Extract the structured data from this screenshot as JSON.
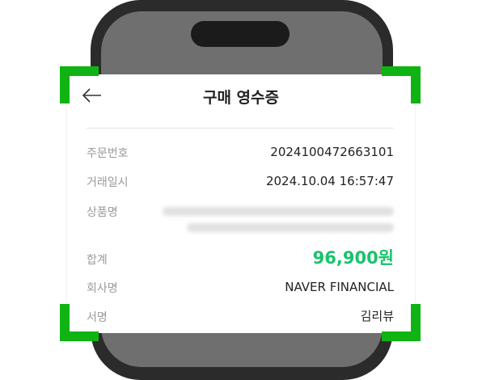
{
  "header": {
    "title": "구매 영수증",
    "back_icon": "arrow-left-icon"
  },
  "receipt": {
    "order_number": {
      "label": "주문번호",
      "value": "2024100472663101"
    },
    "transaction_time": {
      "label": "거래일시",
      "value": "2024.10.04 16:57:47"
    },
    "product_name": {
      "label": "상품명",
      "value_blurred": true
    },
    "total": {
      "label": "합계",
      "value": "96,900원"
    },
    "company": {
      "label": "회사명",
      "value": "NAVER FINANCIAL"
    },
    "signature": {
      "label": "서명",
      "value": "김리뷰"
    }
  },
  "colors": {
    "accent_green": "#19c36b",
    "corner_green": "#0fb313",
    "phone_body": "#2b2b2b"
  }
}
